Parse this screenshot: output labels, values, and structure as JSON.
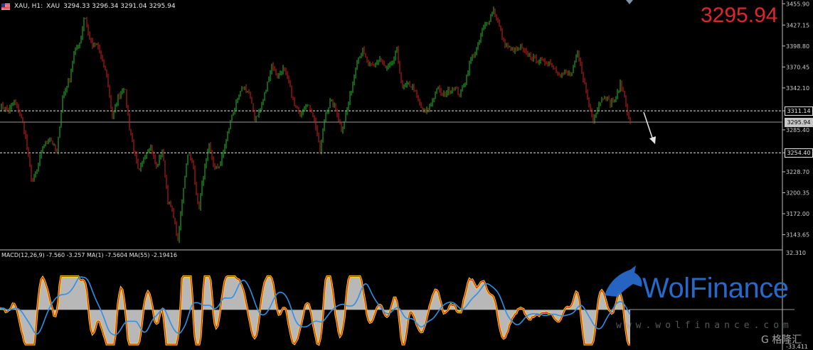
{
  "header": {
    "symbol_period": "XAU, H1:",
    "symbol_name": "XAU",
    "ohlc": "3294.33 3296.34 3291.04 3295.94"
  },
  "big_price": "3295.94",
  "macd_header": "MACD(12,26,9) -7.560 -3.257 MA(1) -7.5604 MA(55) -2.19416",
  "watermark": {
    "brand": "WolFinance",
    "url": "www.wolfinance.com",
    "corner": "G 格隆汇"
  },
  "colors": {
    "background": "#000000",
    "bull_candle": "#22c026",
    "bear_candle": "#d81e1e",
    "level_line": "#e6e6e6",
    "macd_fill": "#c8c8c8",
    "macd_line": "#e1181c",
    "macd_edge": "#f4e21a",
    "ma_line": "#2f8fe6",
    "big_price": "#e0262b",
    "brand": "#2a6fd6"
  },
  "chart_data": [
    {
      "type": "candlestick",
      "title": "XAU, H1",
      "ylim": [
        3125,
        3461
      ],
      "ticks": [
        "3455.90",
        "3427.15",
        "3398.80",
        "3370.45",
        "3342.10",
        "3311.14",
        "3285.40",
        "3254.40",
        "3228.70",
        "3200.35",
        "3172.00",
        "3143.65"
      ],
      "price_tags": [
        {
          "value": 3311.14,
          "label": "3311.14",
          "style": "line"
        },
        {
          "value": 3295.94,
          "label": "3295.94",
          "style": "current"
        },
        {
          "value": 3254.4,
          "label": "3254.40",
          "style": "line"
        }
      ],
      "level_lines": [
        3311.14,
        3254.4
      ],
      "current_price": 3295.94,
      "anchors": [
        [
          0,
          3318
        ],
        [
          12,
          3312
        ],
        [
          20,
          3322
        ],
        [
          28,
          3308
        ],
        [
          35,
          3282
        ],
        [
          45,
          3214
        ],
        [
          52,
          3230
        ],
        [
          60,
          3262
        ],
        [
          70,
          3275
        ],
        [
          80,
          3254
        ],
        [
          88,
          3330
        ],
        [
          98,
          3355
        ],
        [
          105,
          3392
        ],
        [
          113,
          3405
        ],
        [
          119,
          3442
        ],
        [
          124,
          3415
        ],
        [
          130,
          3398
        ],
        [
          137,
          3400
        ],
        [
          143,
          3380
        ],
        [
          150,
          3360
        ],
        [
          158,
          3302
        ],
        [
          166,
          3330
        ],
        [
          175,
          3345
        ],
        [
          182,
          3288
        ],
        [
          188,
          3260
        ],
        [
          195,
          3225
        ],
        [
          203,
          3250
        ],
        [
          211,
          3265
        ],
        [
          220,
          3235
        ],
        [
          228,
          3258
        ],
        [
          236,
          3190
        ],
        [
          244,
          3170
        ],
        [
          250,
          3132
        ],
        [
          257,
          3200
        ],
        [
          264,
          3255
        ],
        [
          272,
          3235
        ],
        [
          279,
          3175
        ],
        [
          286,
          3225
        ],
        [
          294,
          3262
        ],
        [
          302,
          3232
        ],
        [
          310,
          3240
        ],
        [
          318,
          3272
        ],
        [
          326,
          3305
        ],
        [
          334,
          3325
        ],
        [
          342,
          3345
        ],
        [
          350,
          3335
        ],
        [
          358,
          3302
        ],
        [
          366,
          3312
        ],
        [
          374,
          3340
        ],
        [
          382,
          3374
        ],
        [
          390,
          3358
        ],
        [
          398,
          3368
        ],
        [
          406,
          3350
        ],
        [
          414,
          3318
        ],
        [
          422,
          3308
        ],
        [
          430,
          3320
        ],
        [
          438,
          3312
        ],
        [
          445,
          3286
        ],
        [
          450,
          3255
        ],
        [
          457,
          3305
        ],
        [
          465,
          3325
        ],
        [
          473,
          3312
        ],
        [
          480,
          3285
        ],
        [
          488,
          3312
        ],
        [
          495,
          3345
        ],
        [
          502,
          3380
        ],
        [
          510,
          3392
        ],
        [
          518,
          3372
        ],
        [
          526,
          3372
        ],
        [
          534,
          3382
        ],
        [
          542,
          3368
        ],
        [
          550,
          3372
        ],
        [
          558,
          3392
        ],
        [
          566,
          3340
        ],
        [
          574,
          3348
        ],
        [
          582,
          3342
        ],
        [
          590,
          3318
        ],
        [
          598,
          3308
        ],
        [
          606,
          3320
        ],
        [
          614,
          3342
        ],
        [
          622,
          3332
        ],
        [
          630,
          3338
        ],
        [
          638,
          3344
        ],
        [
          646,
          3332
        ],
        [
          654,
          3352
        ],
        [
          662,
          3380
        ],
        [
          670,
          3392
        ],
        [
          678,
          3420
        ],
        [
          686,
          3432
        ],
        [
          694,
          3448
        ],
        [
          700,
          3432
        ],
        [
          708,
          3405
        ],
        [
          716,
          3395
        ],
        [
          724,
          3392
        ],
        [
          732,
          3396
        ],
        [
          740,
          3388
        ],
        [
          748,
          3384
        ],
        [
          756,
          3380
        ],
        [
          764,
          3376
        ],
        [
          772,
          3378
        ],
        [
          780,
          3368
        ],
        [
          788,
          3360
        ],
        [
          796,
          3362
        ],
        [
          804,
          3362
        ],
        [
          812,
          3388
        ],
        [
          820,
          3356
        ],
        [
          828,
          3318
        ],
        [
          834,
          3300
        ],
        [
          842,
          3322
        ],
        [
          850,
          3332
        ],
        [
          858,
          3322
        ],
        [
          866,
          3328
        ],
        [
          872,
          3348
        ],
        [
          878,
          3332
        ],
        [
          884,
          3298
        ],
        [
          886,
          3296
        ]
      ]
    },
    {
      "type": "line",
      "title": "MACD(12,26,9)",
      "ylim": [
        -33.411,
        32.31
      ],
      "ticks": [
        "32.310",
        "-33.411"
      ],
      "series": [
        {
          "name": "MACD",
          "values": [
            -7.56
          ]
        },
        {
          "name": "MA(1)",
          "values": [
            -7.5604
          ]
        },
        {
          "name": "MA(55)",
          "values": [
            -2.19416
          ]
        }
      ]
    }
  ]
}
